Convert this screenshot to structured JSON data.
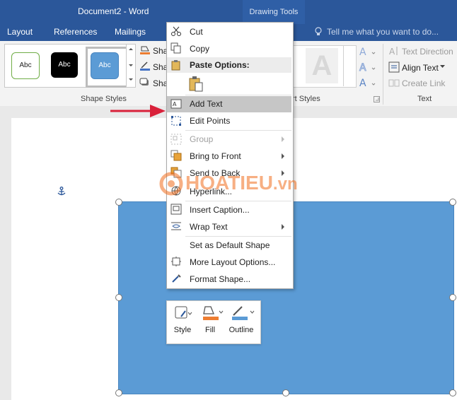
{
  "window": {
    "title": "Document2 - Word",
    "context_tab_group": "Drawing Tools"
  },
  "tabs": [
    "Layout",
    "References",
    "Mailings"
  ],
  "tell_me": {
    "placeholder": "Tell me what you want to do..."
  },
  "ribbon": {
    "shape_styles": {
      "samples": [
        "Abc",
        "Abc",
        "Abc"
      ],
      "partial_buttons": [
        "Sha",
        "Sha",
        "Sha"
      ],
      "group_label": "Shape Styles"
    },
    "wordart_styles": {
      "group_label": "rt Styles",
      "preview_letter": "A"
    },
    "text_group": {
      "text_direction": "Text Direction",
      "align_text": "Align Text",
      "create_link": "Create Link",
      "group_label": "Text"
    }
  },
  "context_menu": {
    "cut": "Cut",
    "copy": "Copy",
    "paste_options": "Paste Options:",
    "add_text": "Add Text",
    "edit_points": "Edit Points",
    "group": "Group",
    "bring_to_front": "Bring to Front",
    "send_to_back": "Send to Back",
    "hyperlink": "Hyperlink...",
    "insert_caption": "Insert Caption...",
    "wrap_text": "Wrap Text",
    "set_default": "Set as Default Shape",
    "more_layout": "More Layout Options...",
    "format_shape": "Format Shape..."
  },
  "mini_toolbar": {
    "style": "Style",
    "fill": "Fill",
    "outline": "Outline"
  },
  "watermark": {
    "brand": "HOATIEU",
    "suffix": ".vn"
  },
  "colors": {
    "title_blue": "#2b579a",
    "shape_fill": "#5b9bd5",
    "arrow_red": "#d9213a",
    "fill_orange": "#ed7d31"
  }
}
